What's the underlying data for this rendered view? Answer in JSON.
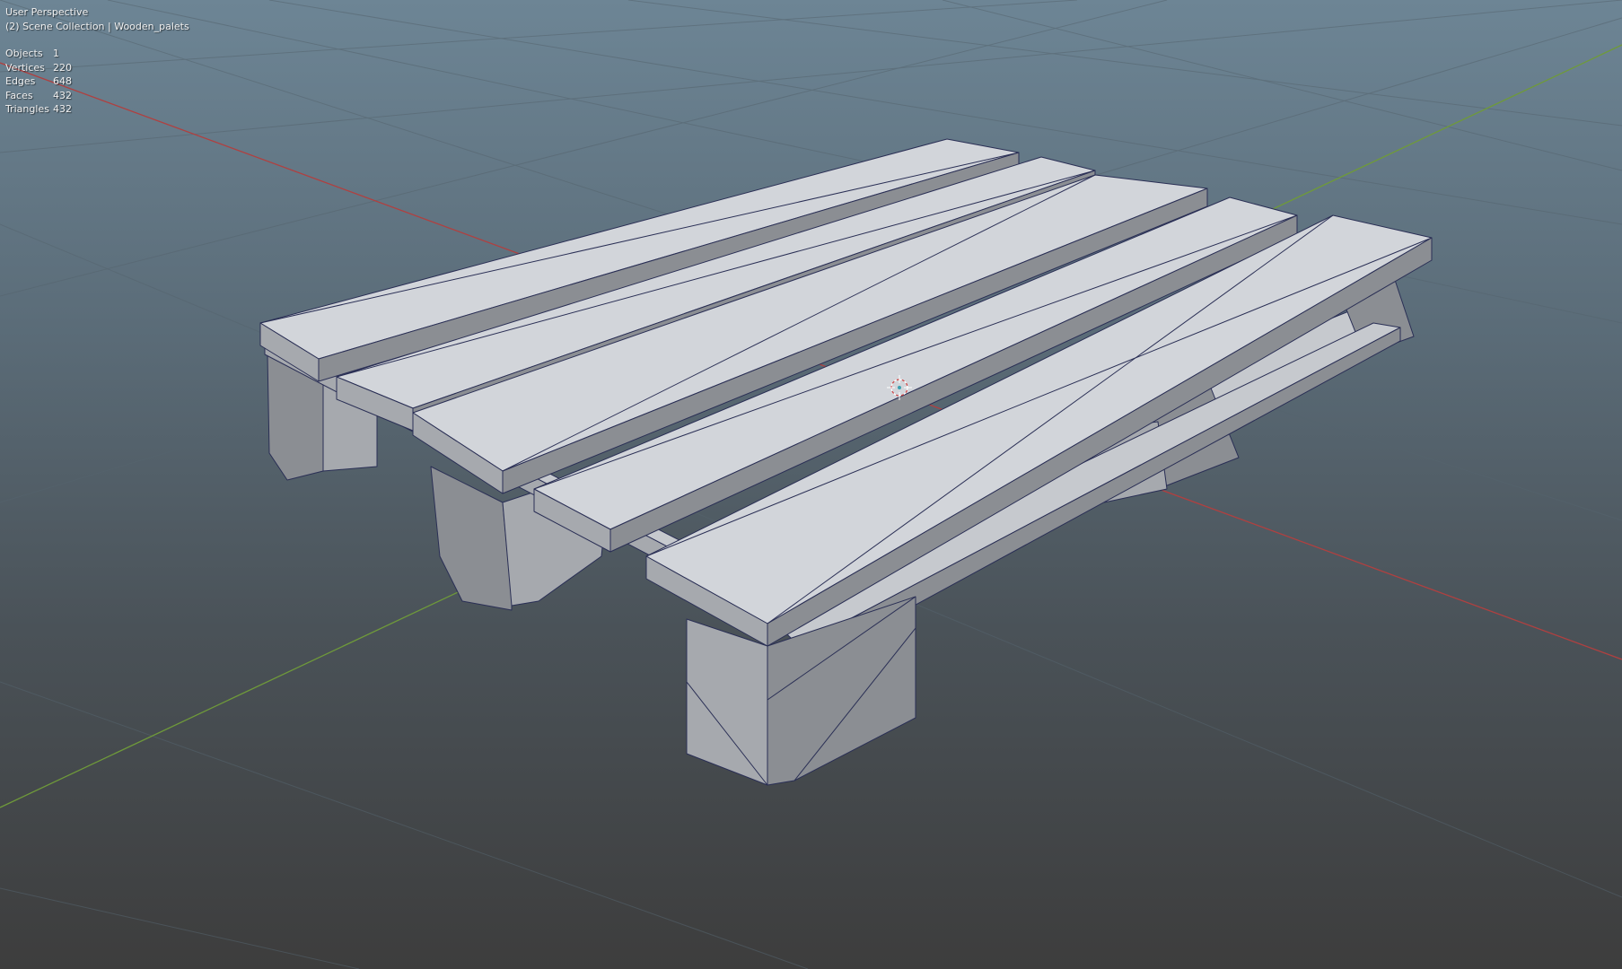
{
  "viewport": {
    "view_name": "User Perspective",
    "collection_path": "(2) Scene Collection | Wooden_palets",
    "axis_colors": {
      "x_axis": "#b04040",
      "y_axis": "#6f9a3a",
      "grid": "#55646e"
    },
    "mesh_colors": {
      "top_face": "#d2d5da",
      "side_face": "#a6a9ae",
      "dark_face": "#7b7e83",
      "wire": "#2a2f55"
    }
  },
  "stats": [
    {
      "label": "Objects",
      "value": "1"
    },
    {
      "label": "Vertices",
      "value": "220"
    },
    {
      "label": "Edges",
      "value": "648"
    },
    {
      "label": "Faces",
      "value": "432"
    },
    {
      "label": "Triangles",
      "value": "432"
    }
  ],
  "icons": {
    "origin": "3d-cursor-icon"
  }
}
